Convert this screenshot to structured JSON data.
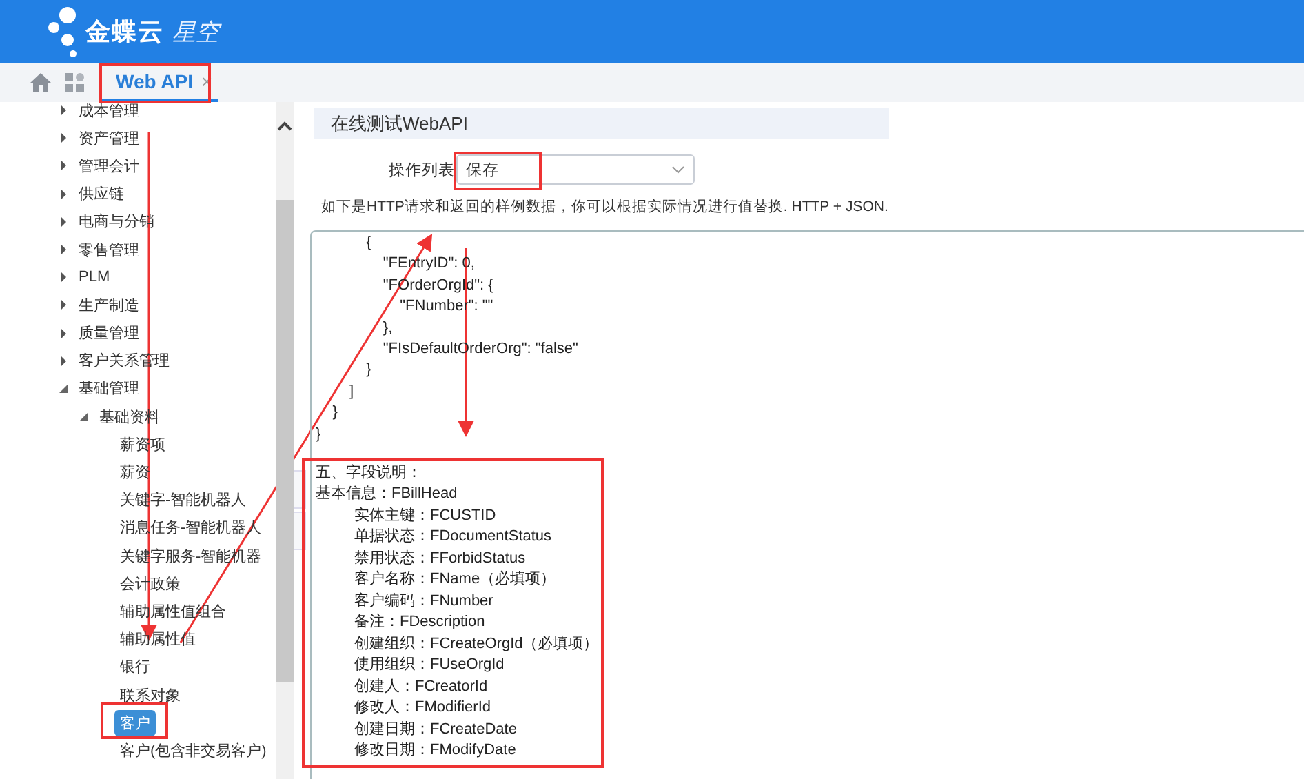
{
  "header": {
    "logo_text": "金蝶云",
    "logo_subtext": "星空"
  },
  "tabs": [
    {
      "label": "Web API",
      "selected": true,
      "close": "×"
    }
  ],
  "tree": [
    {
      "label": "成本管理",
      "expanded": false,
      "selected": false
    },
    {
      "label": "资产管理",
      "expanded": false,
      "selected": false
    },
    {
      "label": "管理会计",
      "expanded": false,
      "selected": false
    },
    {
      "label": "供应链",
      "expanded": false,
      "selected": false
    },
    {
      "label": "电商与分销",
      "expanded": false,
      "selected": false
    },
    {
      "label": "零售管理",
      "expanded": false,
      "selected": false
    },
    {
      "label": "PLM",
      "expanded": false,
      "selected": false
    },
    {
      "label": "生产制造",
      "expanded": false,
      "selected": false
    },
    {
      "label": "质量管理",
      "expanded": false,
      "selected": false
    },
    {
      "label": "客户关系管理",
      "expanded": false,
      "selected": false
    },
    {
      "label": "基础管理",
      "expanded": true,
      "selected": false,
      "children": [
        {
          "label": "基础资料",
          "expanded": true,
          "selected": false,
          "children": [
            {
              "label": "薪资项",
              "selected": false
            },
            {
              "label": "薪资",
              "selected": false
            },
            {
              "label": "关键字-智能机器人",
              "selected": false
            },
            {
              "label": "消息任务-智能机器人",
              "selected": false
            },
            {
              "label": "关键字服务-智能机器",
              "selected": false
            },
            {
              "label": "会计政策",
              "selected": false
            },
            {
              "label": "辅助属性值组合",
              "selected": false
            },
            {
              "label": "辅助属性值",
              "selected": false
            },
            {
              "label": "银行",
              "selected": false
            },
            {
              "label": "联系对象",
              "selected": false
            },
            {
              "label": "客户",
              "selected": true
            },
            {
              "label": "客户(包含非交易客户)",
              "selected": false
            }
          ]
        }
      ]
    }
  ],
  "panel": {
    "title": "在线测试WebAPI",
    "select_label": "操作列表",
    "select_value": "保存",
    "hint": "如下是HTTP请求和返回的样例数据，你可以根据实际情况进行值替换. HTTP + JSON.",
    "code_lines": [
      "            {",
      "                \"FEntryID\": 0,",
      "                \"FOrderOrgId\": {",
      "                    \"FNumber\": \"\"",
      "                },",
      "                \"FIsDefaultOrderOrg\": \"false\"",
      "            }",
      "        ]",
      "    }",
      "}"
    ]
  },
  "field_notes": {
    "heading": "五、字段说明：",
    "groups": [
      {
        "label": "基本信息：FBillHead",
        "children": [
          "实体主键：FCUSTID",
          "单据状态：FDocumentStatus",
          "禁用状态：FForbidStatus",
          "客户名称：FName（必填项）",
          "客户编码：FNumber",
          "备注：FDescription",
          "创建组织：FCreateOrgId（必填项）",
          "使用组织：FUseOrgId",
          "创建人：FCreatorId",
          "修改人：FModifierId",
          "创建日期：FCreateDate",
          "修改日期：FModifyDate"
        ]
      }
    ]
  }
}
